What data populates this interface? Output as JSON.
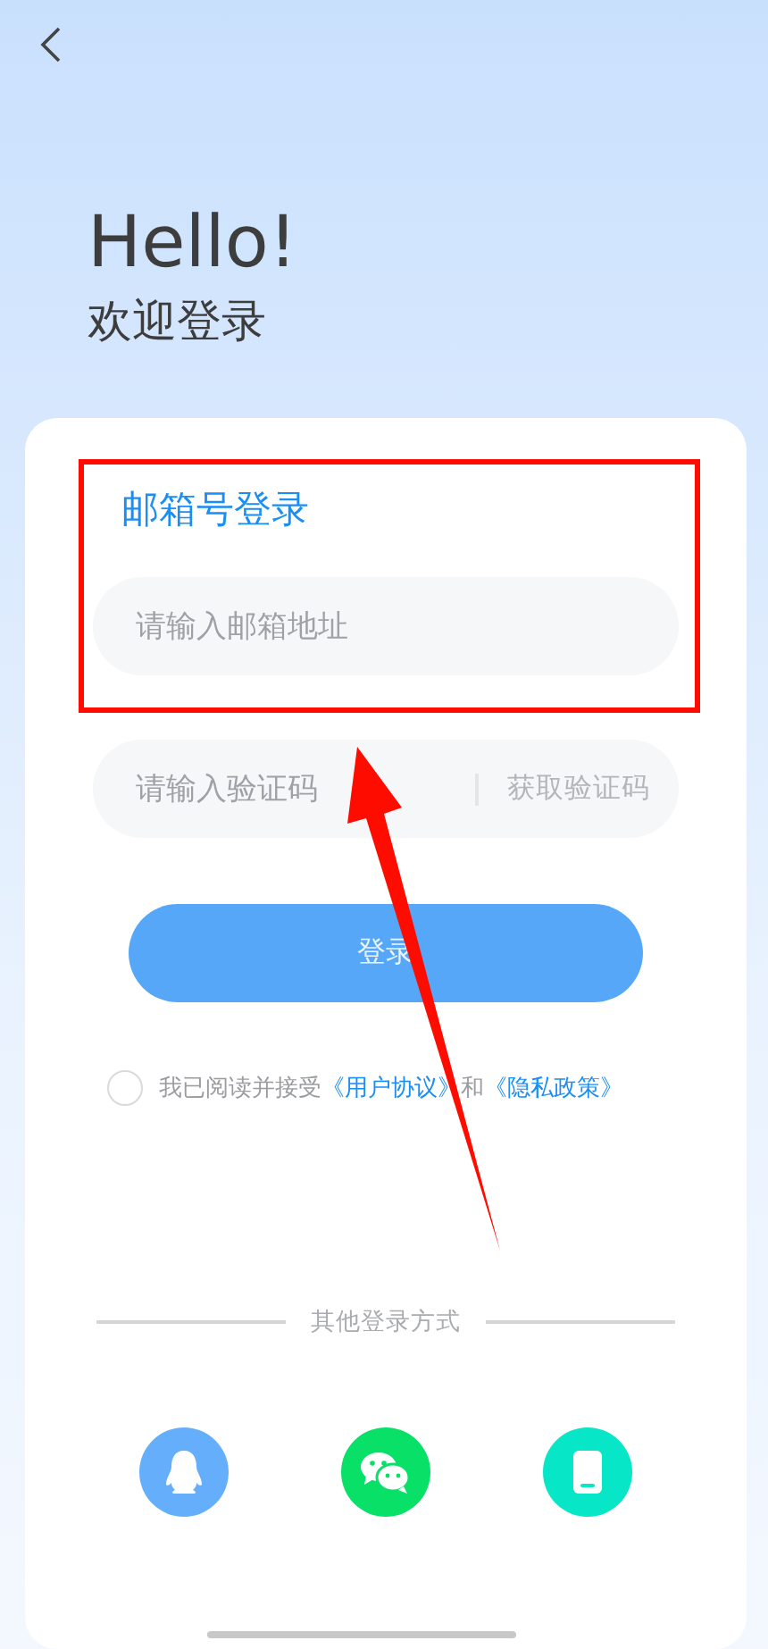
{
  "header": {
    "greeting": "Hello!",
    "subtitle": "欢迎登录"
  },
  "form": {
    "title": "邮箱号登录",
    "email_field": {
      "placeholder": "请输入邮箱地址"
    },
    "code_field": {
      "placeholder": "请输入验证码",
      "action": "获取验证码"
    },
    "login_button": {
      "label": "登录",
      "disabled": true
    },
    "agreement": {
      "checked": false,
      "prefix": "我已阅读并接受",
      "link_1": "《用户协议》",
      "joiner": "和",
      "link_2": "《隐私政策》"
    },
    "other_methods": {
      "label": "其他登录方式",
      "options": [
        {
          "kind": "qq",
          "color": "#64aefc"
        },
        {
          "kind": "wechat",
          "color": "#08e068"
        },
        {
          "kind": "phone",
          "color": "#07e6c6"
        }
      ]
    }
  }
}
